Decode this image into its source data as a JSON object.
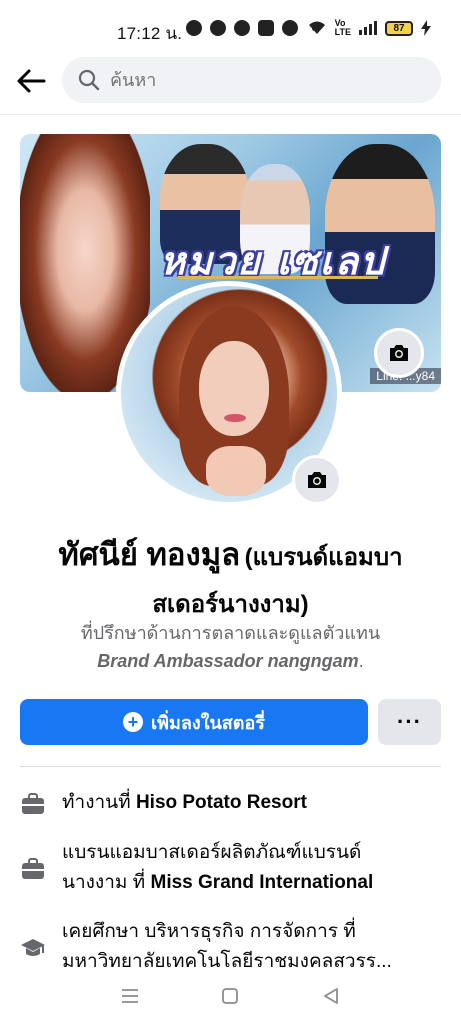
{
  "status_bar": {
    "time": "17:12 น.",
    "battery": "87"
  },
  "header": {
    "search_placeholder": "ค้นหา"
  },
  "cover": {
    "title_art": "หมวย เซเลป",
    "watermark": "Line: ...y84"
  },
  "profile": {
    "name_main": "ทัศนีย์ ทองมูล",
    "name_sub_1": "(แบรนด์แอมบา",
    "name_sub_2": "สเดอร์นางงาม)",
    "bio_line_1": "ที่ปรึกษาด้านการตลาดและดูแลตัวแทน",
    "bio_line_2_en": "Brand Ambassador nangngam",
    "bio_line_2_end": "."
  },
  "actions": {
    "add_story_label": "เพิ่มลงในสตอรี่",
    "more_label": "···"
  },
  "details": [
    {
      "icon": "briefcase-icon",
      "prefix": "ทำงานที่ ",
      "bold": "Hiso Potato Resort"
    },
    {
      "icon": "briefcase-icon",
      "line1": "แบรนแอมบาสเดอร์ผลิตภัณฑ์แบรนด์",
      "prefix": "นางงาม ที่ ",
      "bold": "Miss Grand International"
    },
    {
      "icon": "graduation-cap-icon",
      "line1": "เคยศึกษา บริหารธุรกิจ การจัดการ ที่",
      "line2": "มหาวิทยาลัยเทคโนโลยีราชมงคลสุวรร..."
    }
  ],
  "colors": {
    "primary": "#1877f2",
    "secondary_button": "#e4e6eb",
    "muted_text": "#65676b"
  }
}
